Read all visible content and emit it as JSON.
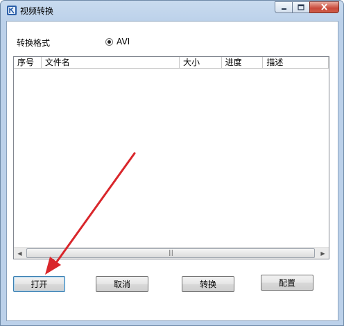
{
  "window": {
    "title": "视频转换",
    "icon": "app-video-icon",
    "caption_buttons": [
      "minimize-icon",
      "maximize-icon",
      "close-icon"
    ]
  },
  "format": {
    "label": "转换格式",
    "option_label": "AVI",
    "selected": true
  },
  "table": {
    "columns": [
      "序号",
      "文件名",
      "大小",
      "进度",
      "描述"
    ],
    "rows": []
  },
  "buttons": {
    "open": "打开",
    "cancel": "取消",
    "convert": "转换",
    "config": "配置"
  },
  "colors": {
    "annotation_arrow": "#d9262b",
    "title_bar": "#bcd1ea",
    "close_button": "#c9493a"
  }
}
